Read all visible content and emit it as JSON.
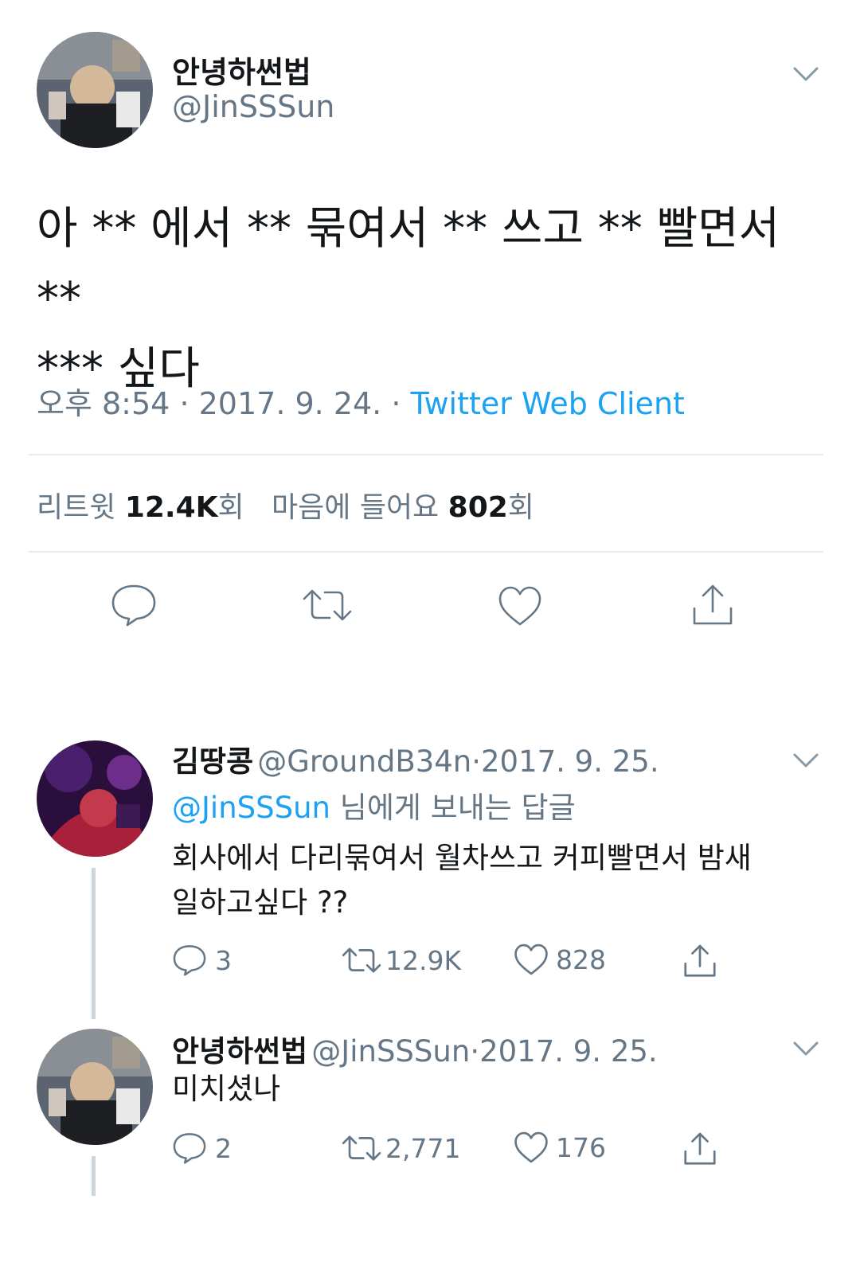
{
  "main_tweet": {
    "display_name": "안녕하썬법",
    "handle": "@JinSSSun",
    "text_line1": "아 ** 에서 ** 묶여서 ** 쓰고 ** 빨면서 **",
    "text_line2": "*** 싶다",
    "time": "오후 8:54",
    "date": "2017. 9. 24.",
    "client": "Twitter Web Client",
    "sep": "·",
    "retweets_label": "리트윗",
    "retweets_count": "12.4K",
    "likes_label": "마음에 들어요",
    "likes_count": "802",
    "count_suffix": "회"
  },
  "replies": [
    {
      "display_name": "김땅콩",
      "handle": "@GroundB34n",
      "date": "2017. 9. 25.",
      "reply_to_handle": "@JinSSSun",
      "reply_to_suffix": "님에게 보내는 답글",
      "text_line1": "회사에서 다리묶여서 월차쓰고 커피빨면서 밤새",
      "text_line2": "일하고싶다 ??",
      "replies": "3",
      "retweets": "12.9K",
      "likes": "828"
    },
    {
      "display_name": "안녕하썬법",
      "handle": "@JinSSSun",
      "date": "2017. 9. 25.",
      "text_line1": "미치셨나",
      "replies": "2",
      "retweets": "2,771",
      "likes": "176"
    }
  ],
  "colors": {
    "link_blue": "#1da1f2",
    "gray_text": "#657786",
    "divider": "#e6ecf0"
  },
  "icons": [
    "chevron-down-icon",
    "reply-icon",
    "retweet-icon",
    "like-icon",
    "share-icon"
  ]
}
